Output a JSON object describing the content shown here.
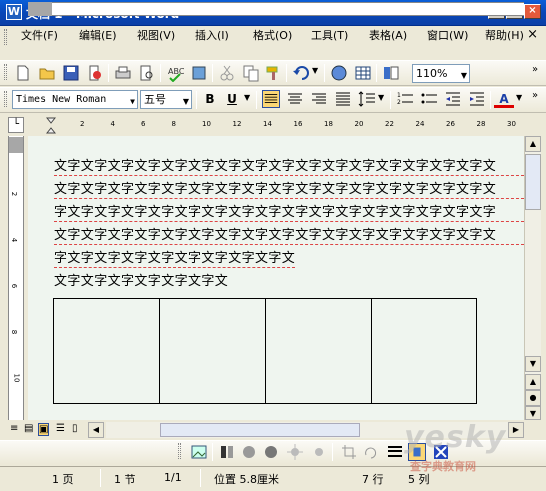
{
  "window": {
    "title": "文档 1 - Microsoft Word",
    "title_icon": "W",
    "min_label": "_",
    "max_label": "□",
    "close_label": "×"
  },
  "menu": {
    "items": [
      {
        "label": "文件(F)"
      },
      {
        "label": "编辑(E)"
      },
      {
        "label": "视图(V)"
      },
      {
        "label": "插入(I)"
      },
      {
        "label": "格式(O)"
      },
      {
        "label": "工具(T)"
      },
      {
        "label": "表格(A)"
      },
      {
        "label": "窗口(W)"
      },
      {
        "label": "帮助(H)"
      }
    ],
    "doc_close": "×"
  },
  "standard_toolbar": {
    "zoom": "110%"
  },
  "format_toolbar": {
    "font_name": "Times New Roman",
    "font_size": "五号",
    "bold": "B",
    "underline": "U",
    "font_color_label": "A"
  },
  "ruler": {
    "ticks": [
      "2",
      "4",
      "6",
      "8",
      "10",
      "12",
      "14",
      "16",
      "18",
      "20",
      "22",
      "24",
      "26",
      "28",
      "30"
    ],
    "vticks": [
      "2",
      "4",
      "6",
      "8",
      "10"
    ]
  },
  "document": {
    "lines": [
      "文字文字文字文字文字文字文字文字文字文字文字文字文字文字文字文字文",
      "文字文字文字文字文字文字文字文字文字文字文字文字文字文字文字文字文",
      "字文字文字文字文字文字文字文字文字文字文字文字文字文字文字文字文字",
      "文字文字文字文字文字文字文字文字文字文字文字文字文字文字文字文字文",
      "字文字文字文字文字文字文字文字文字文",
      "文字文字文字文字文字文字文"
    ],
    "table_columns": 4
  },
  "statusbar": {
    "page": "1 页",
    "section": "1 节",
    "page_of": "1/1",
    "position": "位置 5.8厘米",
    "line": "7 行",
    "column": "5 列"
  },
  "watermark": {
    "text": "yesky",
    "sub": "查字典教育网"
  },
  "colors": {
    "titlebar": "#0a5fd8",
    "doc_bg": "#eff5ef",
    "spell_underline": "#d44"
  }
}
